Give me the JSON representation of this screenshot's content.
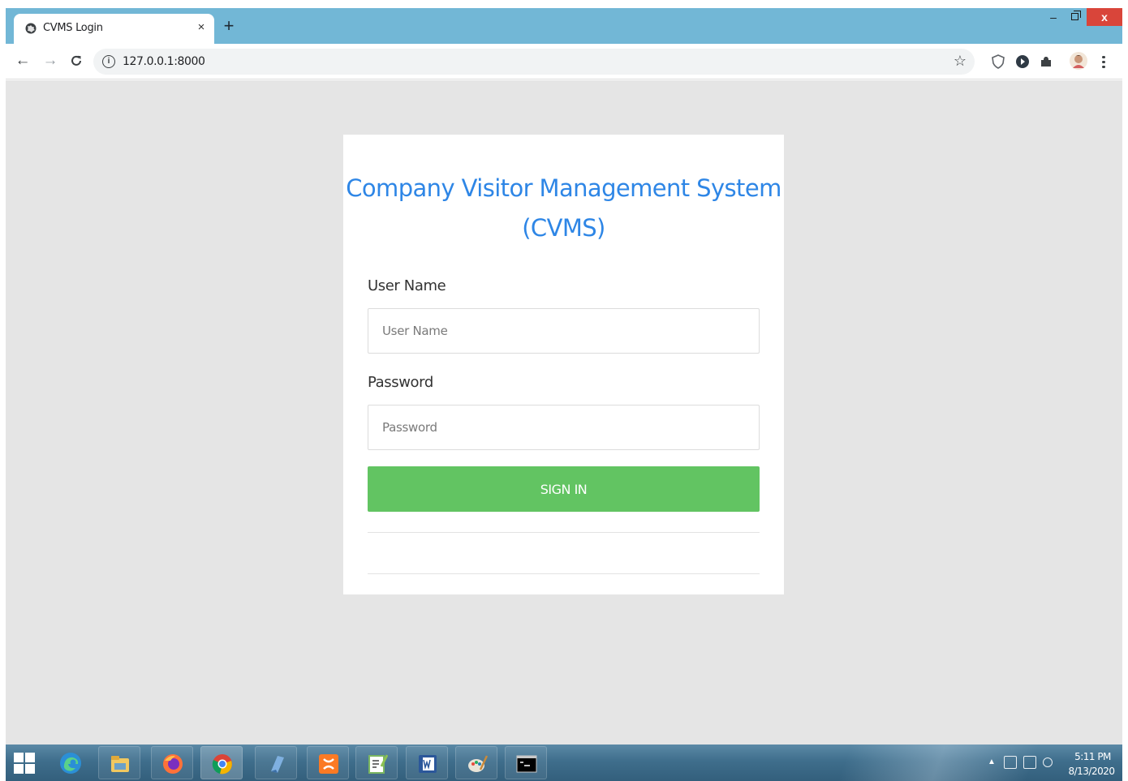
{
  "browser": {
    "tab": {
      "title": "CVMS Login",
      "close": "×"
    },
    "new_tab": "+",
    "window_controls": {
      "minimize": "–",
      "close": "x"
    },
    "address_bar": {
      "url": "127.0.0.1:8000",
      "info": "i"
    },
    "icons": [
      "back-arrow-icon",
      "forward-arrow-icon",
      "reload-icon",
      "info-icon",
      "bookmark-star-icon",
      "extension-shield-icon",
      "extension-circle-icon",
      "puzzle-extensions-icon",
      "profile-avatar-icon",
      "menu-dots-icon"
    ]
  },
  "login": {
    "title": "Company Visitor Management System (CVMS)",
    "username": {
      "label": "User Name",
      "placeholder": "User Name"
    },
    "password": {
      "label": "Password",
      "placeholder": "Password"
    },
    "signin_label": "SIGN IN"
  },
  "taskbar": {
    "apps": [
      "edge-icon",
      "file-explorer-icon",
      "firefox-icon",
      "chrome-icon",
      "app-icon",
      "xampp-icon",
      "notepad-plus-icon",
      "word-icon",
      "paint-icon",
      "command-prompt-icon"
    ],
    "clock": {
      "time": "5:11 PM",
      "date": "8/13/2020"
    }
  },
  "colors": {
    "tab_strip": "#72b7d6",
    "title": "#2e86e6",
    "signin": "#62c462",
    "close": "#d9453a",
    "page_background": "#e5e5e5"
  }
}
